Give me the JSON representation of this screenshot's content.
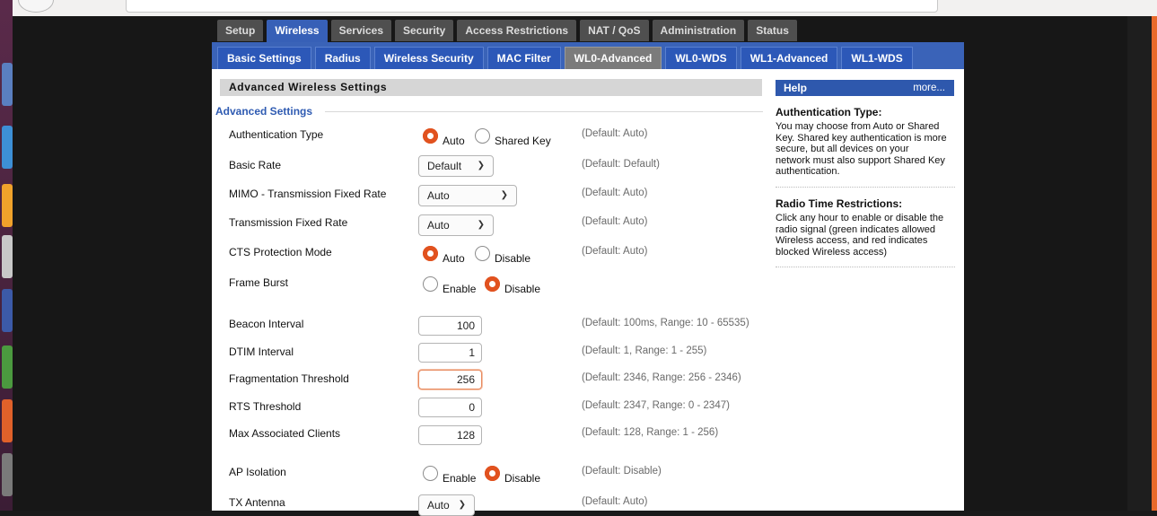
{
  "main_tabs": [
    "Setup",
    "Wireless",
    "Services",
    "Security",
    "Access Restrictions",
    "NAT / QoS",
    "Administration",
    "Status"
  ],
  "main_active": "Wireless",
  "sub_tabs": [
    "Basic Settings",
    "Radius",
    "Wireless Security",
    "MAC Filter",
    "WL0-Advanced",
    "WL0-WDS",
    "WL1-Advanced",
    "WL1-WDS"
  ],
  "sub_active": "WL0-Advanced",
  "section_title": "Advanced Wireless Settings",
  "fieldset_legend": "Advanced Settings",
  "settings": {
    "auth_type": {
      "label": "Authentication Type",
      "opt1": "Auto",
      "opt2": "Shared Key",
      "selected": "Auto",
      "default": "(Default: Auto)"
    },
    "basic_rate": {
      "label": "Basic Rate",
      "value": "Default",
      "default": "(Default: Default)"
    },
    "mimo_rate": {
      "label": "MIMO - Transmission Fixed Rate",
      "value": "Auto",
      "default": "(Default: Auto)"
    },
    "tx_rate": {
      "label": "Transmission Fixed Rate",
      "value": "Auto",
      "default": "(Default: Auto)"
    },
    "cts": {
      "label": "CTS Protection Mode",
      "opt1": "Auto",
      "opt2": "Disable",
      "selected": "Auto",
      "default": "(Default: Auto)"
    },
    "frame_burst": {
      "label": "Frame Burst",
      "opt1": "Enable",
      "opt2": "Disable",
      "selected": "Disable"
    },
    "beacon": {
      "label": "Beacon Interval",
      "value": "100",
      "default": "(Default: 100ms, Range: 10 - 65535)"
    },
    "dtim": {
      "label": "DTIM Interval",
      "value": "1",
      "default": "(Default: 1, Range: 1 - 255)"
    },
    "frag": {
      "label": "Fragmentation Threshold",
      "value": "256",
      "default": "(Default: 2346, Range: 256 - 2346)"
    },
    "rts": {
      "label": "RTS Threshold",
      "value": "0",
      "default": "(Default: 2347, Range: 0 - 2347)"
    },
    "max_clients": {
      "label": "Max Associated Clients",
      "value": "128",
      "default": "(Default: 128, Range: 1 - 256)"
    },
    "ap_isolation": {
      "label": "AP Isolation",
      "opt1": "Enable",
      "opt2": "Disable",
      "selected": "Disable",
      "default": "(Default: Disable)"
    },
    "tx_antenna": {
      "label": "TX Antenna",
      "value": "Auto",
      "default": "(Default: Auto)"
    }
  },
  "help": {
    "title": "Help",
    "more": "more...",
    "items": [
      {
        "title": "Authentication Type:",
        "lines": [
          "You may choose from Auto or Shared",
          "Key. Shared key authentication is more",
          "secure, but all devices on your",
          "network must also support Shared Key",
          "authentication."
        ]
      },
      {
        "title": "Radio Time Restrictions:",
        "lines": [
          "Click any hour to enable or disable the",
          "radio signal (green indicates allowed",
          "Wireless access, and red indicates",
          "blocked Wireless access)"
        ]
      }
    ]
  },
  "colors": {
    "accent": "#3760b7",
    "radio_on": "#e1521f",
    "tab_inactive": "#4f4f4f"
  }
}
